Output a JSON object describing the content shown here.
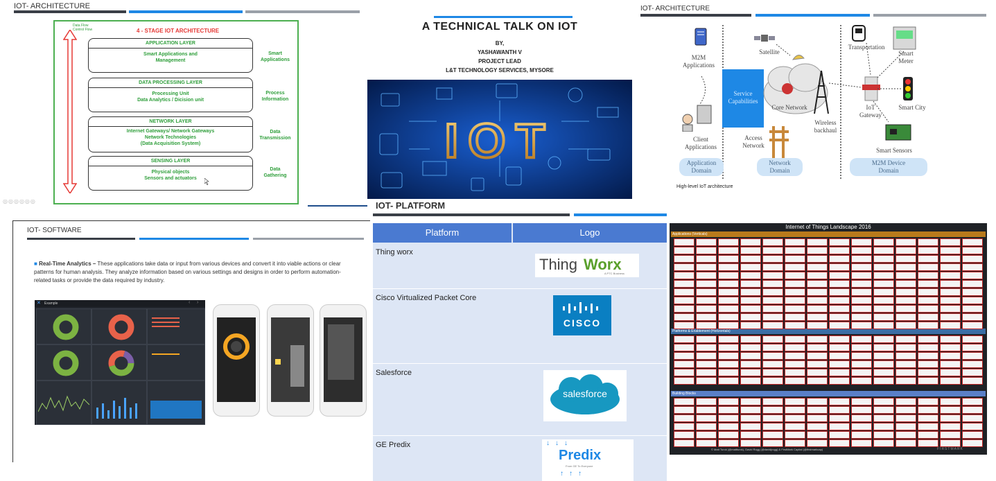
{
  "panel1": {
    "slide_title": "IOT- ARCHITECTURE",
    "flow_label": "Data Flow\nControl Flow",
    "stage_title": "4 - STAGE IOT ARCHITECTURE",
    "layers": [
      {
        "header": "APPLICATION LAYER",
        "body": "Smart Applications and\nManagement",
        "side": "Smart\nApplications"
      },
      {
        "header": "DATA PROCESSING LAYER",
        "body": "Processing Unit\nData Analytics / Dicision unit",
        "side": "Process\nInformation"
      },
      {
        "header": "NETWORK LAYER",
        "body": "Internet Gateways/ Network Gateways\nNetwork Technologies\n(Data Acquisition System)",
        "side": "Data\nTransmission"
      },
      {
        "header": "SENSING LAYER",
        "body": "Physical objects\nSensors and actuators",
        "side": "Data\nGathering"
      }
    ]
  },
  "panel2": {
    "title": "A TECHNICAL TALK ON IOT",
    "by": "BY,",
    "name": "YASHAWANTH V",
    "role": "PROJECT LEAD",
    "company": "L&T TECHNOLOGY SERVICES, MYSORE",
    "banner_text": "IOT"
  },
  "panel3": {
    "slide_title": "IOT- ARCHITECTURE",
    "labels": {
      "m2m_apps": "M2M\nApplications",
      "satellite": "Satellite",
      "transportation": "Transportation",
      "smart_meter": "Smart\nMeter",
      "service_cap": "Service\nCapabilities",
      "core_network": "Core Network",
      "iot_gateway": "IoT\nGateway",
      "smart_city": "Smart City",
      "client_apps": "Client\nApplications",
      "access_network": "Access\nNetwork",
      "wireless": "Wireless\nbackhaul",
      "smart_sensors": "Smart Sensors"
    },
    "domains": [
      "Application\nDomain",
      "Network\nDomain",
      "M2M Device\nDomain"
    ],
    "caption": "High-level IoT architecture"
  },
  "panel4": {
    "slide_title": "IOT- SOFTWARE",
    "bullet_title": "Real-Time Analytics –",
    "bullet_text": "These applications take data or input from various devices and convert it into viable actions or clear patterns for human analysis. They analyze information based on various settings and designs in order to perform automation-related tasks or provide the data required by industry.",
    "dashboard_title": "Example"
  },
  "panel5": {
    "slide_title": "IOT- PLATFORM",
    "col_platform": "Platform",
    "col_logo": "Logo",
    "rows": [
      {
        "name": "Thing worx",
        "logo_a": "Thing",
        "logo_b": "Worx",
        "logo_sub": "A PTC Business"
      },
      {
        "name": "Cisco Virtualized Packet Core",
        "logo": "CISCO"
      },
      {
        "name": "Salesforce",
        "logo": "salesforce"
      },
      {
        "name": "GE Predix",
        "logo": "Predix",
        "logo_sub": "From GE To Everyone"
      }
    ]
  },
  "panel6": {
    "title": "Internet of Things Landscape 2016",
    "sections": [
      "Applications (Verticals)",
      "Platforms & Enablement (Horizontals)",
      "Building Blocks"
    ],
    "footer": "© Matt Turck (@mattturck), David Rogg (@davidjrogg) & FirstMark Capital (@firstmarkcap)",
    "footer_brand": "FIRSTMARK"
  },
  "colors": {
    "green": "#2e9e3a",
    "red": "#e53935",
    "blue": "#1e88e5",
    "table_header": "#4a7ad1"
  }
}
